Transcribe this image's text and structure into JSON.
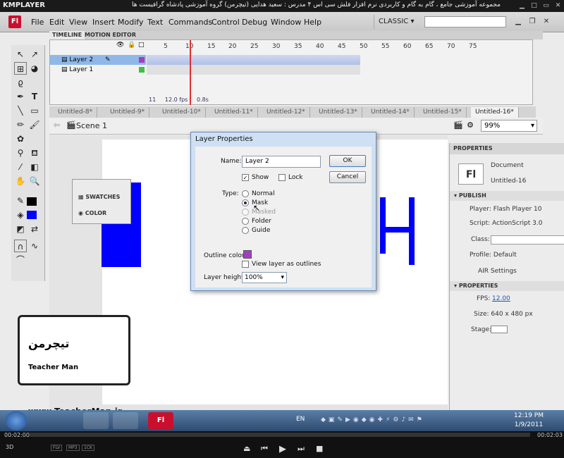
{
  "player": {
    "logo": "KMPLAYER",
    "title": "مجموعه آموزشی جامع ، گام به گام و کاربردی نرم افزار فلش سی اس ۴ مدرس : سعید هدایی (تیچرمن) گروه آموزشی پادشاه گرافیست ها",
    "time_elapsed": "00:02:00",
    "time_total": "00:02:03",
    "badges": [
      "FLV",
      "MP3",
      "1CK"
    ],
    "controls": [
      "eject",
      "prev",
      "play",
      "next",
      "stop"
    ]
  },
  "menubar": {
    "logo": "Fl",
    "items": [
      "File",
      "Edit",
      "View",
      "Insert",
      "Modify",
      "Text",
      "Commands",
      "Control",
      "Debug",
      "Window",
      "Help"
    ],
    "workspace": "CLASSIC"
  },
  "timeline": {
    "tabs": [
      "TIMELINE",
      "MOTION EDITOR"
    ],
    "ruler": [
      "5",
      "10",
      "15",
      "20",
      "25",
      "30",
      "35",
      "40",
      "45",
      "50",
      "55",
      "60",
      "65",
      "70",
      "75"
    ],
    "layers": [
      {
        "name": "Layer 2"
      },
      {
        "name": "Layer 1"
      }
    ],
    "status": {
      "frame": "11",
      "fps": "12.0",
      "fps_unit": "fps",
      "time": "0.8s"
    }
  },
  "doc_tabs": [
    "Untitled-8*",
    "Untitled-9*",
    "Untitled-10*",
    "Untitled-11*",
    "Untitled-12*",
    "Untitled-13*",
    "Untitled-14*",
    "Untitled-15*",
    "Untitled-16*"
  ],
  "editbar": {
    "scene": "Scene 1",
    "zoom": "99%"
  },
  "panel_swatches": {
    "swatches": "SWATCHES",
    "color": "COLOR"
  },
  "properties": {
    "tab": "PROPERTIES",
    "doc_label": "Document",
    "doc_name": "Untitled-16",
    "publish": "PUBLISH",
    "player": "Player: Flash Player 10",
    "script": "Script: ActionScript 3.0",
    "class": "Class:",
    "profile": "Profile: Default",
    "air": "AIR Settings",
    "props": "PROPERTIES",
    "fps_label": "FPS:",
    "fps": "12.00",
    "size": "Size: 640 x 480 px",
    "stage": "Stage:"
  },
  "dialog": {
    "title": "Layer Properties",
    "name_label": "Name:",
    "name_value": "Layer 2",
    "ok": "OK",
    "cancel": "Cancel",
    "show": "Show",
    "lock": "Lock",
    "type_label": "Type:",
    "types": [
      "Normal",
      "Mask",
      "Masked",
      "Folder",
      "Guide"
    ],
    "selected_type": "Mask",
    "outline_label": "Outline color:",
    "outline_color": "#a040c0",
    "view_outline": "View layer as outlines",
    "height_label": "Layer height:",
    "height_value": "100%"
  },
  "overlay": {
    "logo": "تیچرمن",
    "name": "Teacher Man",
    "url": "www.TeacherMan.ir"
  },
  "taskbar": {
    "lang": "EN",
    "time": "12:19 PM",
    "date": "1/9/2011"
  },
  "colors": {
    "shape": "#0000ff",
    "layer_selected": "#8fb8e8",
    "playhead": "#e03030"
  }
}
